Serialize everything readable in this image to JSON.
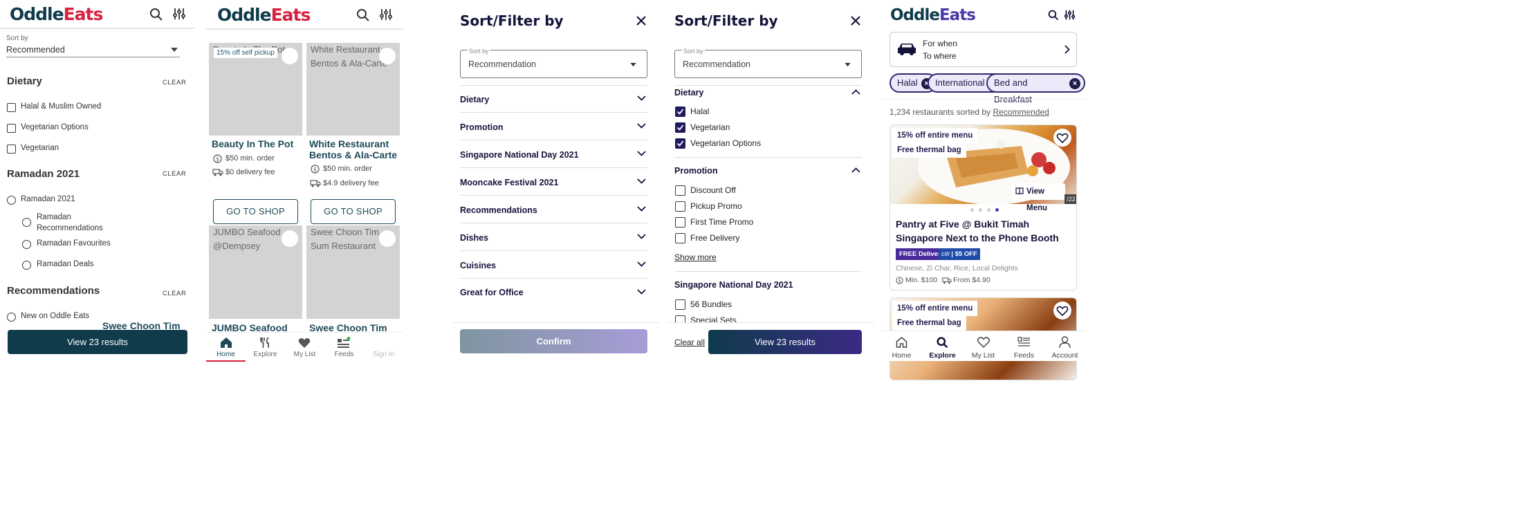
{
  "brand": {
    "part1": "Oddle",
    "part2": "Eats"
  },
  "p1": {
    "sort_label": "Sort by",
    "sort_value": "Recommended",
    "sections": [
      {
        "title": "Dietary",
        "clear": "CLEAR",
        "items": [
          "Halal & Muslim Owned",
          "Vegetarian Options",
          "Vegetarian"
        ]
      },
      {
        "title": "Ramadan 2021",
        "clear": "CLEAR",
        "items": [
          "Ramadan 2021",
          "Ramadan Recommendations",
          "Ramadan Favourites",
          "Ramadan Deals"
        ]
      },
      {
        "title": "Recommendations",
        "clear": "CLEAR",
        "items": [
          "New on Oddle Eats"
        ]
      }
    ],
    "behind_text": "Swee Choon Tim",
    "button": "View 23 results"
  },
  "p2": {
    "cards": [
      {
        "alt": "Beauty In The Pot",
        "promo": "15% off self pickup",
        "name": "Beauty In The Pot",
        "min_order": "$50 min. order",
        "fee": "$0 delivery fee",
        "button": "GO TO SHOP"
      },
      {
        "alt": "White Restaurant Bentos & Ala-Carte",
        "name": "White Restaurant Bentos & Ala-Carte",
        "min_order": "$50 min. order",
        "fee": "$4.9 delivery fee",
        "button": "GO TO SHOP"
      },
      {
        "alt": "JUMBO Seafood @Dempsey",
        "name": "JUMBO Seafood"
      },
      {
        "alt": "Swee Choon Tim Sum Restaurant",
        "name": "Swee Choon Tim"
      }
    ],
    "nav": [
      "Home",
      "Explore",
      "My List",
      "Feeds",
      "Sign In"
    ]
  },
  "p3": {
    "title": "Sort/Filter by",
    "sort_label": "Sort by",
    "sort_value": "Recommendation",
    "sections": [
      "Dietary",
      "Promotion",
      "Singapore National Day 2021",
      "Mooncake Festival 2021",
      "Recommendations",
      "Dishes",
      "Cuisines",
      "Great for Office"
    ],
    "button": "Confirm"
  },
  "p4": {
    "title": "Sort/Filter by",
    "sort_label": "Sort by",
    "sort_value": "Recommendation",
    "dietary_title": "Dietary",
    "dietary_items": [
      "Halal",
      "Vegetarian",
      "Vegetarian Options"
    ],
    "promotion_title": "Promotion",
    "promotion_items": [
      "Discount Off",
      "Pickup Promo",
      "First Time Promo",
      "Free Delivery"
    ],
    "show_more": "Show more",
    "national_title": "Singapore National Day 2021",
    "national_items": [
      "56 Bundles",
      "Special Sets"
    ],
    "clear_all": "Clear all",
    "button": "View 23 results"
  },
  "p5": {
    "location_line1": "For when",
    "location_line2": "To where",
    "chips": [
      "Halal",
      "International",
      "Bed and Breakfast"
    ],
    "result_count": "1,234 restaurants sorted by",
    "result_sort": "Recommended",
    "card1": {
      "promo1": "15% off entire menu",
      "promo2": "Free thermal bag",
      "view_menu": "View Menu",
      "photo_count": "/22",
      "name": "Pantry at Five @ Bukit Timah Singapore Next to the Phone Booth",
      "badge1": "FREE Delivery",
      "badge2_brand": "citi",
      "badge2": "$5 OFF",
      "cuisines": "Chinese, Zi Char, Rice, Local Delights",
      "min": "Min. $100",
      "from": "From $4.90"
    },
    "card2": {
      "promo1": "15% off entire menu",
      "promo2": "Free thermal bag"
    },
    "nav": [
      "Home",
      "Explore",
      "My List",
      "Feeds",
      "Account"
    ]
  },
  "colors": {
    "teal": "#0f3b4b",
    "red": "#d6213f",
    "navy": "#1f1a5c",
    "purple": "#4a3aa8"
  }
}
